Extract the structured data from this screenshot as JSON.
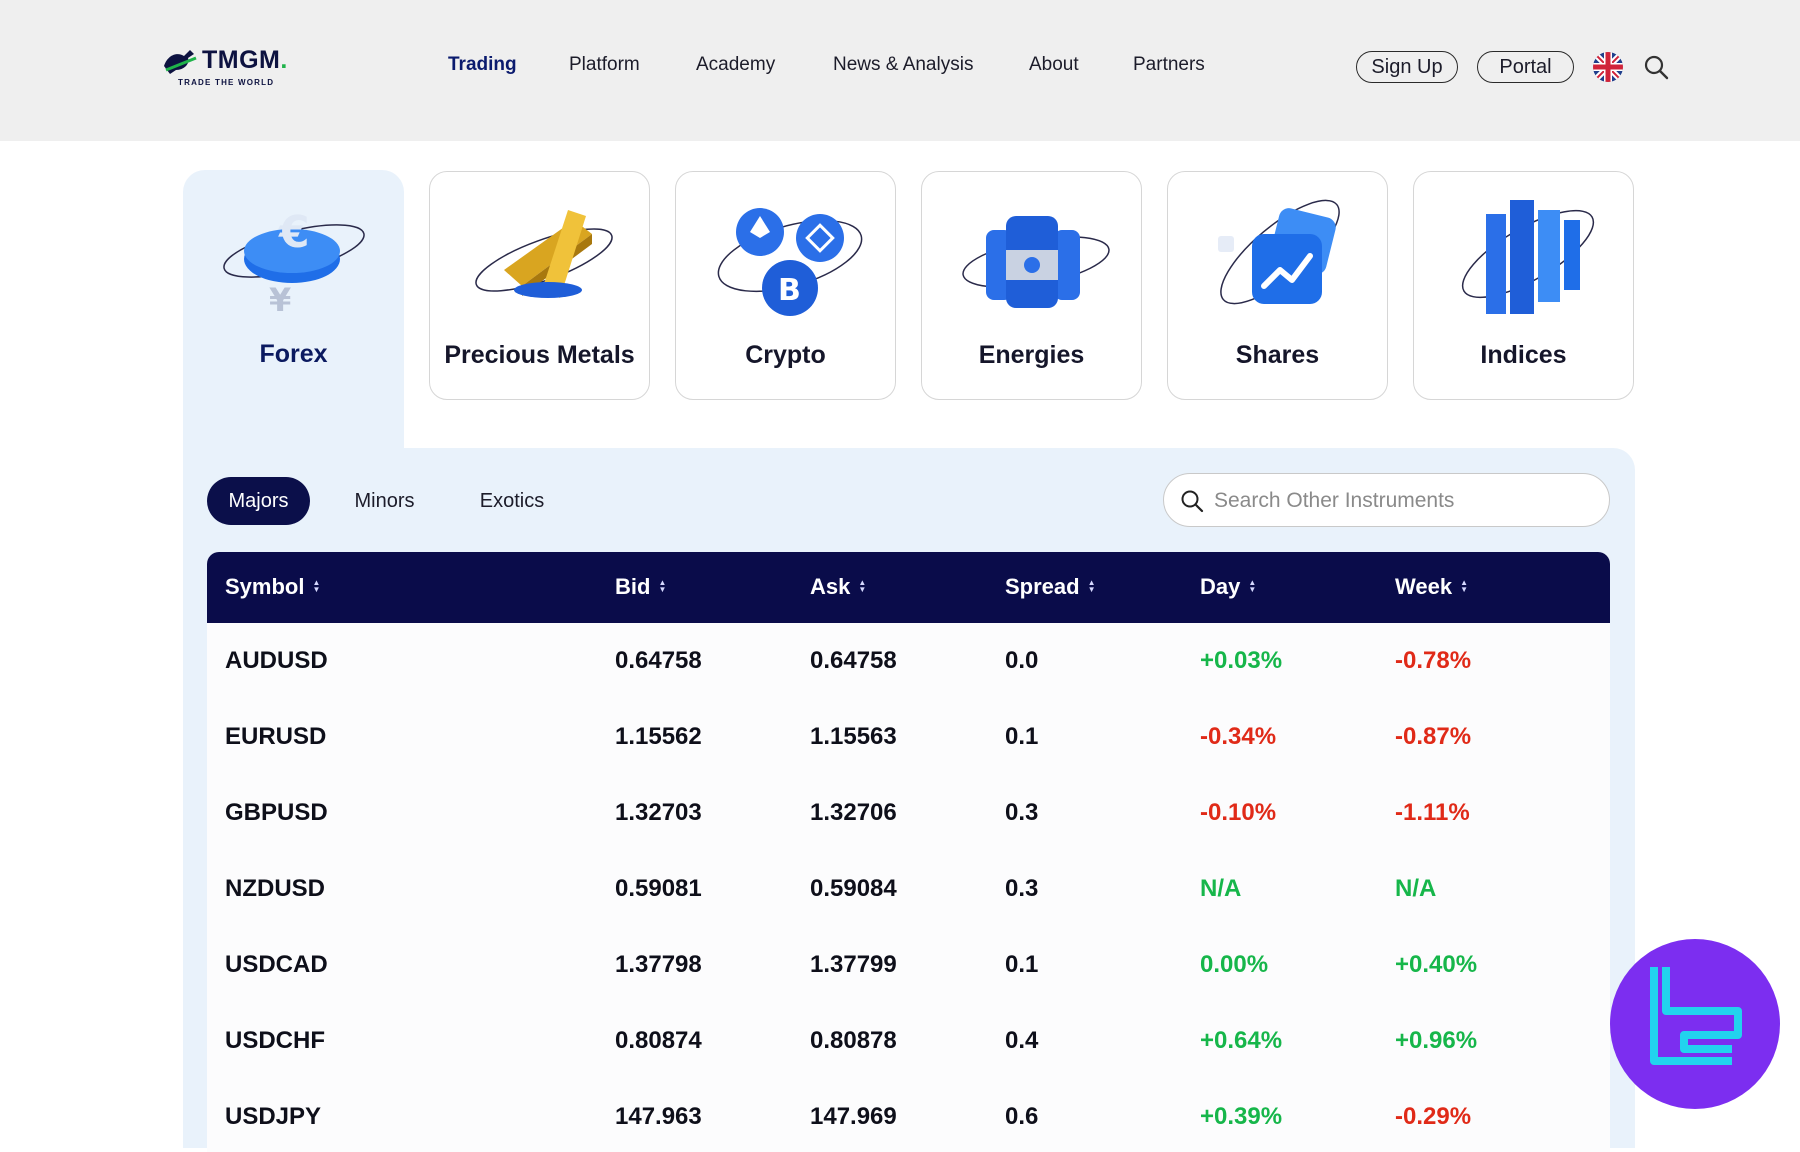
{
  "brand": {
    "name": "TMGM",
    "name_dot": ".",
    "tagline": "TRADE THE WORLD"
  },
  "nav": {
    "items": [
      {
        "label": "Trading",
        "active": true
      },
      {
        "label": "Platform"
      },
      {
        "label": "Academy"
      },
      {
        "label": "News & Analysis"
      },
      {
        "label": "About"
      },
      {
        "label": "Partners"
      }
    ],
    "sign_up": "Sign Up",
    "portal": "Portal",
    "language_icon": "uk-flag-icon",
    "search_icon": "search-icon"
  },
  "categories": [
    {
      "label": "Forex",
      "active": true,
      "icon": "forex-icon"
    },
    {
      "label": "Precious Metals",
      "icon": "gold-bars-icon"
    },
    {
      "label": "Crypto",
      "icon": "crypto-coins-icon"
    },
    {
      "label": "Energies",
      "icon": "oil-barrels-icon"
    },
    {
      "label": "Shares",
      "icon": "shares-icon"
    },
    {
      "label": "Indices",
      "icon": "indices-icon"
    }
  ],
  "tabs": [
    {
      "label": "Majors",
      "active": true
    },
    {
      "label": "Minors"
    },
    {
      "label": "Exotics"
    }
  ],
  "search": {
    "placeholder": "Search Other Instruments"
  },
  "table": {
    "columns": [
      "Symbol",
      "Bid",
      "Ask",
      "Spread",
      "Day",
      "Week"
    ],
    "rows": [
      {
        "symbol": "AUDUSD",
        "bid": "0.64758",
        "ask": "0.64758",
        "spread": "0.0",
        "day": "+0.03%",
        "day_trend": "pos",
        "week": "-0.78%",
        "week_trend": "neg"
      },
      {
        "symbol": "EURUSD",
        "bid": "1.15562",
        "ask": "1.15563",
        "spread": "0.1",
        "day": "-0.34%",
        "day_trend": "neg",
        "week": "-0.87%",
        "week_trend": "neg"
      },
      {
        "symbol": "GBPUSD",
        "bid": "1.32703",
        "ask": "1.32706",
        "spread": "0.3",
        "day": "-0.10%",
        "day_trend": "neg",
        "week": "-1.11%",
        "week_trend": "neg"
      },
      {
        "symbol": "NZDUSD",
        "bid": "0.59081",
        "ask": "0.59084",
        "spread": "0.3",
        "day": "N/A",
        "day_trend": "pos",
        "week": "N/A",
        "week_trend": "pos"
      },
      {
        "symbol": "USDCAD",
        "bid": "1.37798",
        "ask": "1.37799",
        "spread": "0.1",
        "day": "0.00%",
        "day_trend": "pos",
        "week": "+0.40%",
        "week_trend": "pos"
      },
      {
        "symbol": "USDCHF",
        "bid": "0.80874",
        "ask": "0.80878",
        "spread": "0.4",
        "day": "+0.64%",
        "day_trend": "pos",
        "week": "+0.96%",
        "week_trend": "pos"
      },
      {
        "symbol": "USDJPY",
        "bid": "147.963",
        "ask": "147.969",
        "spread": "0.6",
        "day": "+0.39%",
        "day_trend": "pos",
        "week": "-0.29%",
        "week_trend": "neg"
      }
    ]
  },
  "colors": {
    "navy": "#0a0c4a",
    "positive": "#16b64a",
    "negative": "#e02a18",
    "badge": "#7c2ef0",
    "badge_mark": "#22d3ee"
  },
  "watermark_icon": "tc-logo-icon"
}
